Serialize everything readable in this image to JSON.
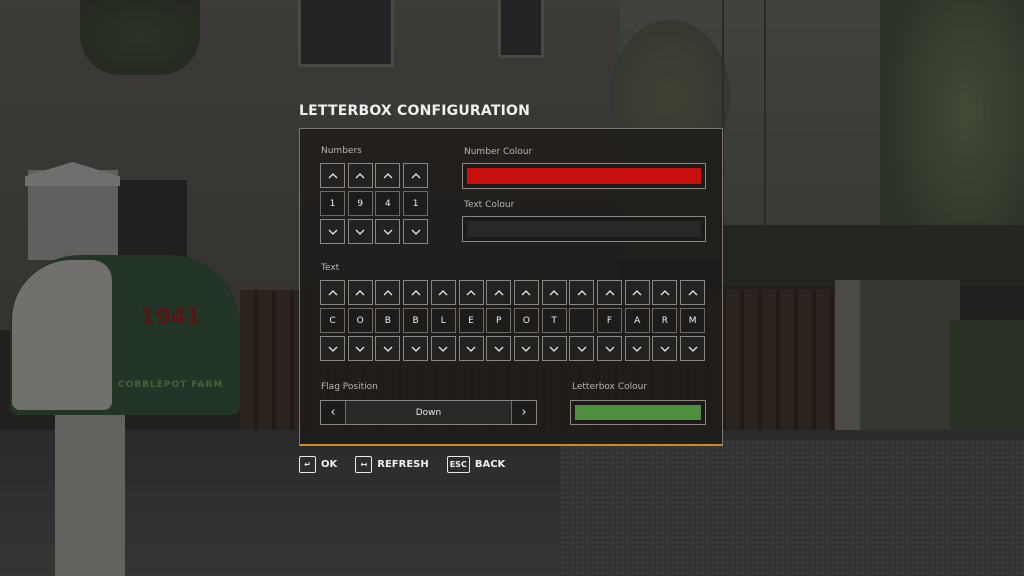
{
  "dialog": {
    "title": "LETTERBOX CONFIGURATION",
    "numbers": {
      "label": "Numbers",
      "values": [
        "1",
        "9",
        "4",
        "1"
      ]
    },
    "number_colour": {
      "label": "Number Colour",
      "value": "#c8110f"
    },
    "text_colour": {
      "label": "Text Colour",
      "value": "#2a2826"
    },
    "text": {
      "label": "Text",
      "characters": [
        "C",
        "O",
        "B",
        "B",
        "L",
        "E",
        "P",
        "O",
        "T",
        "",
        "F",
        "A",
        "R",
        "M"
      ]
    },
    "flag_position": {
      "label": "Flag Position",
      "value": "Down"
    },
    "letterbox_colour": {
      "label": "Letterbox Colour",
      "value": "#4f9040"
    }
  },
  "footer": {
    "ok": {
      "key": "↵",
      "label": "OK"
    },
    "refresh": {
      "key": "↤",
      "label": "REFRESH"
    },
    "back": {
      "key": "ESC",
      "label": "BACK"
    }
  },
  "background": {
    "mailbox_number": "1941",
    "mailbox_text": "COBBLEPOT FARM"
  },
  "colors": {
    "accent_line": "#d08a2a"
  }
}
